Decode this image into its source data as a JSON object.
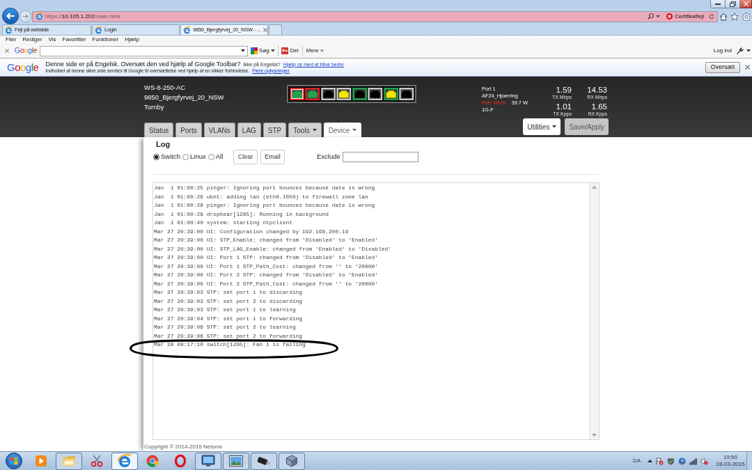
{
  "browser": {
    "url": {
      "scheme": "https://",
      "host": "10.105.1.202",
      "path": "/main.html"
    },
    "security": "Certifikatfejl",
    "tabs": [
      {
        "label": "Fejl på webside",
        "selected": false
      },
      {
        "label": "Login",
        "selected": false
      },
      {
        "label": "9850_Bjergfyrvej_20_NSW - ...",
        "selected": true
      }
    ],
    "menu": [
      "Filer",
      "Rediger",
      "Vis",
      "Favoritter",
      "Funktioner",
      "Hjælp"
    ],
    "toolbar": {
      "logo": "Google",
      "search_button": "Søg",
      "share_button": "Del",
      "more_button": "Mere »",
      "sign_in": "Log ind"
    },
    "translate_bar": {
      "logo": "Google",
      "message": "Denne side er på Engelsk. Oversæt den ved hjælp af Google Toolbar?",
      "not_english": "Ikke på Engelsk?",
      "help_link": "Hjælp os med at blive bedre",
      "detail": "Indholdet af denne sikre side sendes til Google til oversættelse ved hjælp af en sikker forbindelse.",
      "more_link": "Flere oplysninger",
      "button": "Oversæt"
    }
  },
  "device": {
    "model": "WS-8-250-AC",
    "name": "9850_Bjergfyrvej_20_NSW",
    "location": "Tornby"
  },
  "ports": [
    {
      "frame": {
        "color": "#e02020"
      },
      "fill": {
        "color": "#22a34a"
      },
      "selected": true
    },
    {
      "frame": {
        "color": "#e02020"
      },
      "fill": {
        "color": "#22a34a"
      },
      "selected": false
    },
    {
      "frame": {
        "color": "#c8c8c8"
      },
      "fill": {
        "color": "#000000"
      },
      "selected": false
    },
    {
      "frame": {
        "color": "#c8c8c8"
      },
      "fill": {
        "color": "#f2e600"
      },
      "selected": false
    },
    {
      "frame": {
        "color": "#22a34a"
      },
      "fill": {
        "color": "#000000"
      },
      "selected": false
    },
    {
      "frame": {
        "color": "#c8c8c8"
      },
      "fill": {
        "color": "#000000"
      },
      "selected": false
    },
    {
      "frame": {
        "color": "#22a34a"
      },
      "fill": {
        "color": "#f2e600"
      },
      "selected": false
    },
    {
      "frame": {
        "color": "#c8c8c8"
      },
      "fill": {
        "color": "#000000"
      },
      "selected": false
    }
  ],
  "port_info": {
    "port": "Port 1",
    "name": "AF24_Hjoerring",
    "poe": "PoE 48VH",
    "power": "39.7 W",
    "speed": "1G-F"
  },
  "stats": [
    {
      "value": "1.59",
      "unit": "TX Mbps"
    },
    {
      "value": "14.53",
      "unit": "RX Mbps"
    },
    {
      "value": "1.01",
      "unit": "TX Kpps"
    },
    {
      "value": "1.65",
      "unit": "RX Kpps"
    }
  ],
  "tabs": [
    {
      "label": "Status",
      "selected": false,
      "dropdown": false
    },
    {
      "label": "Ports",
      "selected": false,
      "dropdown": false
    },
    {
      "label": "VLANs",
      "selected": false,
      "dropdown": false
    },
    {
      "label": "LAG",
      "selected": false,
      "dropdown": false
    },
    {
      "label": "STP",
      "selected": false,
      "dropdown": false
    },
    {
      "label": "Tools",
      "selected": false,
      "dropdown": true
    },
    {
      "label": "Device",
      "selected": true,
      "dropdown": true
    }
  ],
  "utilities_button": "Utilities",
  "save_button": "Save/Apply",
  "log": {
    "title": "Log",
    "sources": [
      {
        "label": "Switch",
        "selected": true
      },
      {
        "label": "Linux",
        "selected": false
      },
      {
        "label": "All",
        "selected": false
      }
    ],
    "buttons": [
      "Clear",
      "Email"
    ],
    "exclude_label": "Exclude",
    "lines": [
      {
        "text": "Jan  1 01:00:25 pinger: Ignoring port bounces because date is wrong",
        "circled": false
      },
      {
        "text": "Jan  1 01:00:26 ubnt: adding lan (eth0.1050) to firewall zone lan",
        "circled": false
      },
      {
        "text": "Jan  1 01:00:28 pinger: Ignoring port bounces because date is wrong",
        "circled": false
      },
      {
        "text": "Jan  1 01:00:28 dropbear[1285]: Running in background",
        "circled": false
      },
      {
        "text": "Jan  1 01:00:40 system: starting ntpclient",
        "circled": false
      },
      {
        "text": "Mar 27 20:39:00 UI: Configuration changed by 192.168.200.19",
        "circled": false
      },
      {
        "text": "Mar 27 20:39:00 UI: STP_Enable: changed from 'Disabled' to 'Enabled'",
        "circled": false
      },
      {
        "text": "Mar 27 20:39:00 UI: STP_LAG_Enable: changed from 'Enabled' to 'Disabled'",
        "circled": false
      },
      {
        "text": "Mar 27 20:39:00 UI: Port 1 STP: changed from 'Disabled' to 'Enabled'",
        "circled": false
      },
      {
        "text": "Mar 27 20:39:00 UI: Port 1 STP_Path_Cost: changed from '' to '20000'",
        "circled": false
      },
      {
        "text": "Mar 27 20:39:00 UI: Port 2 STP: changed from 'Disabled' to 'Enabled'",
        "circled": false
      },
      {
        "text": "Mar 27 20:39:00 UI: Port 2 STP_Path_Cost: changed from '' to '20000'",
        "circled": false
      },
      {
        "text": "Mar 27 20:39:03 STP: set port 1 to discarding",
        "circled": false
      },
      {
        "text": "Mar 27 20:39:03 STP: set port 2 to discarding",
        "circled": false
      },
      {
        "text": "Mar 27 20:39:03 STP: set port 1 to learning",
        "circled": false
      },
      {
        "text": "Mar 27 20:39:04 STP: set port 1 to forwarding",
        "circled": false
      },
      {
        "text": "Mar 27 20:39:06 STP: set port 2 to learning",
        "circled": false
      },
      {
        "text": "Mar 27 20:39:06 STP: set port 2 to forwarding",
        "circled": false
      },
      {
        "text": "Mar 28 09:17:10 switch[1295]: Fan 1 is failing",
        "circled": true
      }
    ]
  },
  "copyright": "Copyright © 2014-2015 Netonix",
  "taskbar": {
    "apps": [
      {
        "kind": "player",
        "running": false,
        "selected": false
      },
      {
        "kind": "folder",
        "running": true,
        "selected": false
      },
      {
        "kind": "scissors",
        "running": false,
        "selected": false
      },
      {
        "kind": "browser-e",
        "running": true,
        "selected": true
      },
      {
        "kind": "browser-ring",
        "running": false,
        "selected": false
      },
      {
        "kind": "browser-o",
        "running": false,
        "selected": false
      },
      {
        "kind": "monitor",
        "running": true,
        "selected": false
      },
      {
        "kind": "picture",
        "running": true,
        "selected": false
      },
      {
        "kind": "usb",
        "running": true,
        "selected": false
      },
      {
        "kind": "cube",
        "running": true,
        "selected": false
      }
    ],
    "language": "DA",
    "time": "19:50",
    "date": "28-03-2015"
  }
}
